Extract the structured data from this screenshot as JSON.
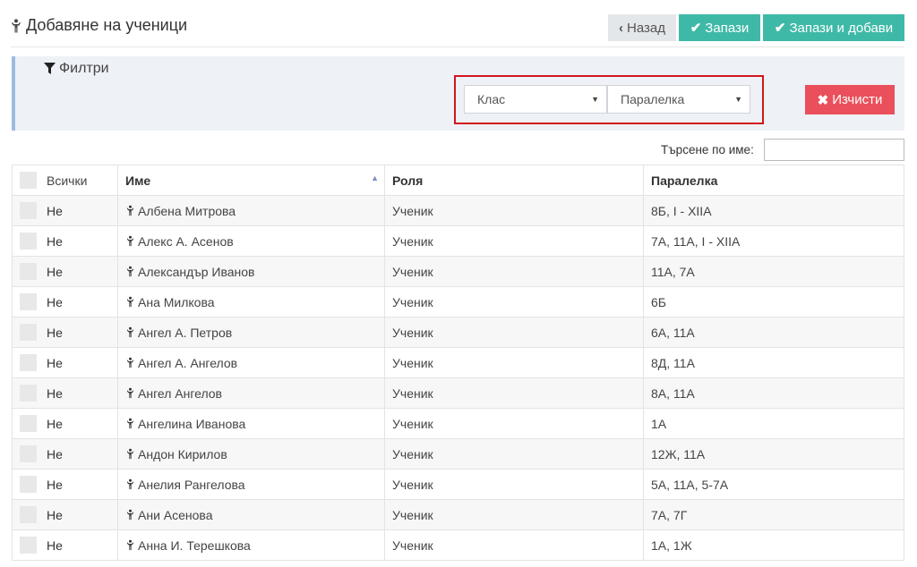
{
  "header": {
    "title": "Добавяне на ученици",
    "back_label": "Назад",
    "save_label": "Запази",
    "save_add_label": "Запази и добави"
  },
  "filters": {
    "title": "Филтри",
    "class_select": "Клас",
    "parallel_select": "Паралелка",
    "clear_label": "Изчисти"
  },
  "search": {
    "label": "Търсене по име:",
    "value": ""
  },
  "table": {
    "columns": {
      "all": "Всички",
      "name": "Име",
      "role": "Роля",
      "parallel": "Паралелка"
    },
    "rows": [
      {
        "check": "Не",
        "name": "Албена Митрова",
        "role": "Ученик",
        "parallel": "8Б, I - XIIА"
      },
      {
        "check": "Не",
        "name": "Алекс А. Асенов",
        "role": "Ученик",
        "parallel": "7А, 11А, I - XIIА"
      },
      {
        "check": "Не",
        "name": "Александър Иванов",
        "role": "Ученик",
        "parallel": "11А, 7А"
      },
      {
        "check": "Не",
        "name": "Ана Милкова",
        "role": "Ученик",
        "parallel": "6Б"
      },
      {
        "check": "Не",
        "name": "Ангел А. Петров",
        "role": "Ученик",
        "parallel": "6А, 11А"
      },
      {
        "check": "Не",
        "name": "Ангел А. Ангелов",
        "role": "Ученик",
        "parallel": "8Д, 11А"
      },
      {
        "check": "Не",
        "name": "Ангел Ангелов",
        "role": "Ученик",
        "parallel": "8А, 11А"
      },
      {
        "check": "Не",
        "name": "Ангелина Иванова",
        "role": "Ученик",
        "parallel": "1А"
      },
      {
        "check": "Не",
        "name": "Андон Кирилов",
        "role": "Ученик",
        "parallel": "12Ж, 11А"
      },
      {
        "check": "Не",
        "name": "Анелия Рангелова",
        "role": "Ученик",
        "parallel": "5А, 11А, 5-7А"
      },
      {
        "check": "Не",
        "name": "Ани Асенова",
        "role": "Ученик",
        "parallel": "7А, 7Г"
      },
      {
        "check": "Не",
        "name": "Анна И. Терешкова",
        "role": "Ученик",
        "parallel": "1А, 1Ж"
      }
    ]
  },
  "colors": {
    "accent": "#3fb9a7",
    "danger": "#e9505b",
    "highlight": "#d0171d",
    "filter_border": "#9dbbe0"
  }
}
